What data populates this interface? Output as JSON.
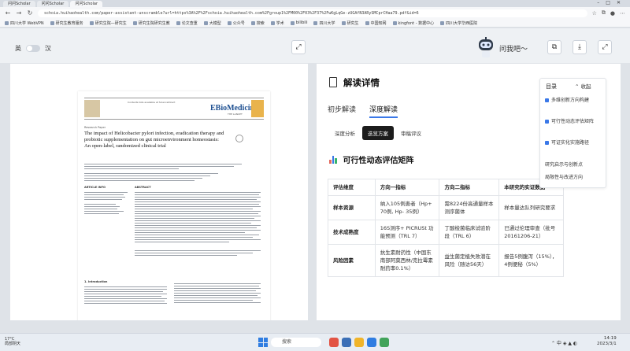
{
  "browser": {
    "tabs": [
      "问问Scholar",
      "问问Scholar",
      "问问Scholar"
    ],
    "url": "schoia.huihaohealth.com/paper-assistant-unscramble?url=https%3A%2F%2Fschoia.huihaohealth.com%2Fgroup1%2FM00%2F03%2F37%2FwKgLqGe-zUGAfN3ARySMCprCHaa79.pdf&id=6",
    "bookmarks": [
      "四川大学 WebVPN",
      "研究生教育服务",
      "研究生院—研究生",
      "研究生院研究生教",
      "论文查重",
      "大模型",
      "公众号",
      "搜索",
      "学术",
      "bilibili",
      "四川大学",
      "研究生",
      "中国知网",
      "kingfont - 数据中心",
      "四川大学华西医院"
    ]
  },
  "toolbar": {
    "lang_en": "英",
    "lang_zh": "汉",
    "ask": "问我吧～"
  },
  "pdf": {
    "contents_line": "Contents lists available at ScienceDirect",
    "journal": "EBioMedicine",
    "publisher": "THE LANCET",
    "article_type": "Research Paper",
    "title": "The impact of Helicobacter pylori infection, eradication therapy and probiotic supplementation on gut microenvironment homeostasis: An open-label, randomized clinical trial",
    "sections": [
      "ARTICLE INFO",
      "ABSTRACT",
      "1. Introduction"
    ]
  },
  "detail": {
    "title": "解读详情",
    "tabs": [
      "初步解读",
      "深度解读"
    ],
    "pills": [
      "深度分析",
      "迭览方案",
      "审稿评议"
    ],
    "section_title": "可行性动态评估矩阵",
    "table": {
      "headers": [
        "评估维度",
        "方向一指标",
        "方向二指标",
        "本研究的实证数据"
      ],
      "rows": [
        [
          "样本资源",
          "纳入105例患者（Hp+ 70例, Hp- 35例）",
          "需8224份高通量样本测序菌体",
          "样本量达队列研究要求"
        ],
        [
          "技术成熟度",
          "16S测序+ PICRUSt 功能预测（TRL 7）",
          "丁酸梭菌临床试验阶段（TRL 6）",
          "已通过伦理审查（批号20161206-21）"
        ],
        [
          "风险因素",
          "抗生素耐药性（中国东南部阿莫西林/克拉霉素耐药率0.1%）",
          "益生菌定植失败潜在风险（随访56天）",
          "报告5例腹泻（15%），4例便秘（5%）"
        ]
      ]
    }
  },
  "toc": {
    "title": "目录",
    "collapse": "收起",
    "items": [
      "多维创新方向构建",
      "可行性动态评估矩阵",
      "可证实化实施路径",
      "研究启示与创新点",
      "局限性与改进方向"
    ]
  },
  "taskbar": {
    "temp": "17°C",
    "weather": "局部阴天",
    "search": "搜索",
    "time": "14:19",
    "date": "2023/3/1"
  }
}
